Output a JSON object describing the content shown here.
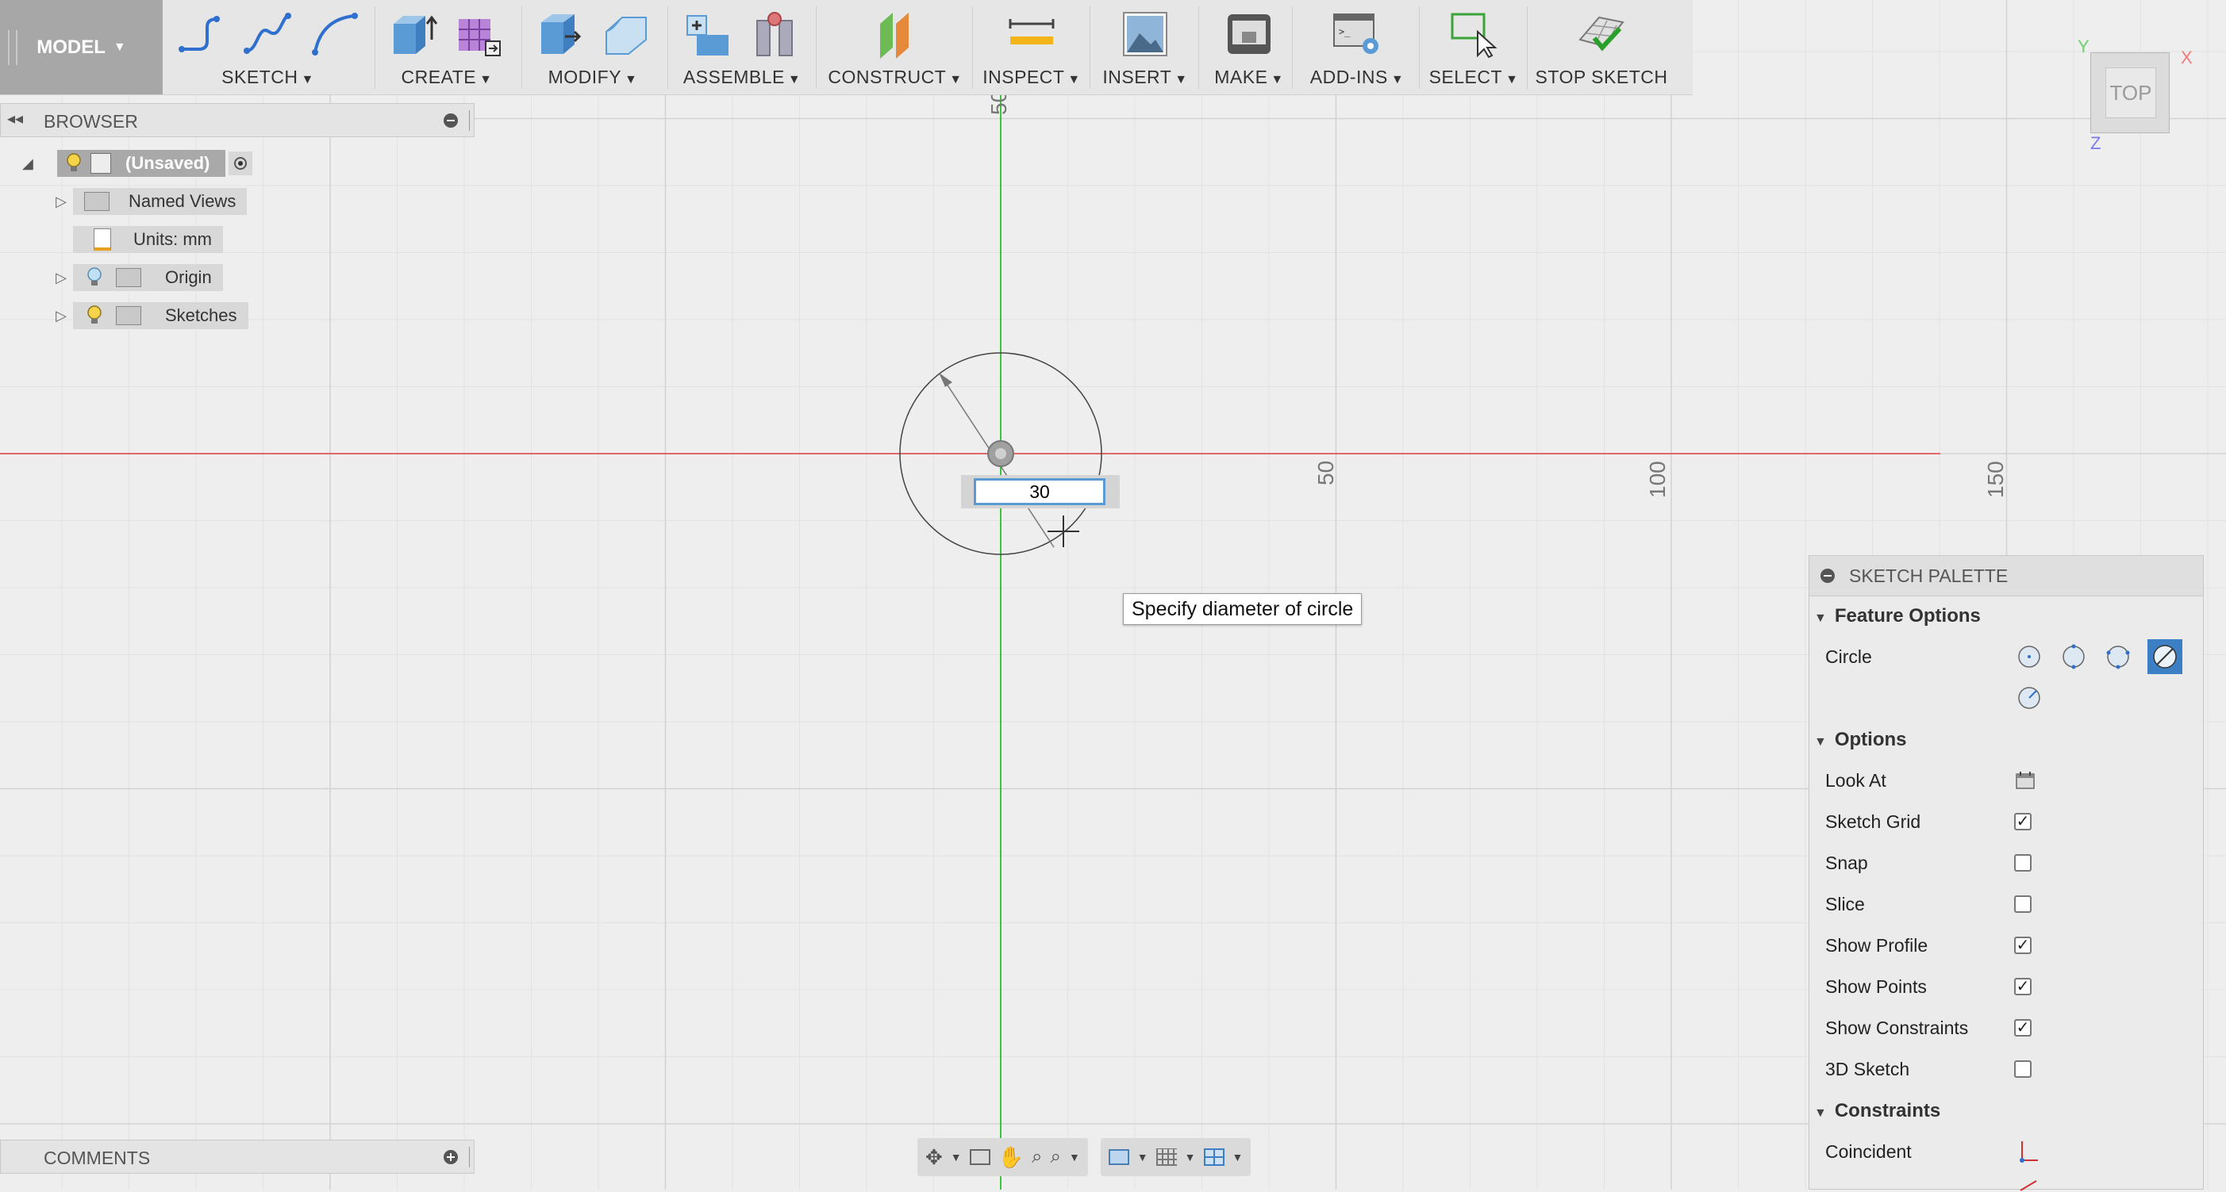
{
  "toolbar": {
    "workspace": "MODEL",
    "groups": [
      {
        "label": "SKETCH"
      },
      {
        "label": "CREATE"
      },
      {
        "label": "MODIFY"
      },
      {
        "label": "ASSEMBLE"
      },
      {
        "label": "CONSTRUCT"
      },
      {
        "label": "INSPECT"
      },
      {
        "label": "INSERT"
      },
      {
        "label": "MAKE"
      },
      {
        "label": "ADD-INS"
      },
      {
        "label": "SELECT"
      },
      {
        "label": "STOP SKETCH"
      }
    ]
  },
  "browser": {
    "title": "BROWSER",
    "root": "(Unsaved)",
    "items": [
      {
        "label": "Named Views"
      },
      {
        "label": "Units: mm"
      },
      {
        "label": "Origin"
      },
      {
        "label": "Sketches"
      }
    ]
  },
  "comments": {
    "title": "COMMENTS"
  },
  "canvas": {
    "ruler_labels": [
      "50",
      "50",
      "100",
      "150"
    ],
    "dimension_value": "30",
    "tooltip": "Specify diameter of circle",
    "axis_colors": {
      "x": "#e04040",
      "y": "#3cc43c"
    }
  },
  "viewcube": {
    "face": "TOP",
    "x": "X",
    "y": "Y",
    "z": "Z"
  },
  "palette": {
    "title": "SKETCH PALETTE",
    "feature_options": "Feature Options",
    "circle_label": "Circle",
    "options": "Options",
    "rows": [
      {
        "label": "Look At"
      },
      {
        "label": "Sketch Grid",
        "checked": true
      },
      {
        "label": "Snap",
        "checked": false
      },
      {
        "label": "Slice",
        "checked": false
      },
      {
        "label": "Show Profile",
        "checked": true
      },
      {
        "label": "Show Points",
        "checked": true
      },
      {
        "label": "Show Constraints",
        "checked": true
      },
      {
        "label": "3D Sketch",
        "checked": false
      }
    ],
    "constraints": "Constraints",
    "constraint_rows": [
      {
        "label": "Coincident"
      }
    ]
  }
}
